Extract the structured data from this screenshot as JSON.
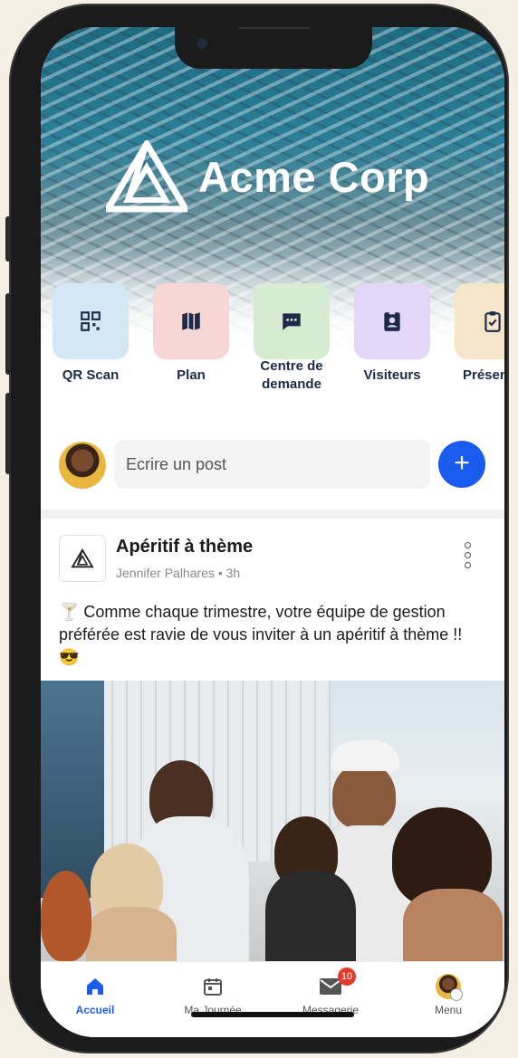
{
  "app": {
    "brand_name": "Acme Corp"
  },
  "shortcuts": [
    {
      "label": "QR Scan",
      "icon": "qr-code-icon",
      "color": "#d3e7f4"
    },
    {
      "label": "Plan",
      "icon": "map-icon",
      "color": "#f6d7d6"
    },
    {
      "label": "Centre de demande",
      "icon": "chat-bubble-icon",
      "color": "#d6ecd1"
    },
    {
      "label": "Visiteurs",
      "icon": "badge-icon",
      "color": "#e3d6f7"
    },
    {
      "label": "Présen",
      "icon": "clipboard-check-icon",
      "color": "#f5e6c9"
    }
  ],
  "composer": {
    "placeholder": "Ecrire un post",
    "add_label": "+"
  },
  "post": {
    "title": "Apéritif à thème",
    "meta": "Jennifer Palhares • 3h",
    "body": "🍸 Comme chaque trimestre, votre équipe de gestion préférée est ravie de vous inviter à un apéritif à thème !! 😎"
  },
  "tabbar": {
    "tabs": [
      {
        "label": "Accueil",
        "icon": "home-icon",
        "active": true
      },
      {
        "label": "Ma Journée",
        "icon": "calendar-icon"
      },
      {
        "label": "Messagerie",
        "icon": "mail-icon",
        "badge": "10"
      },
      {
        "label": "Menu",
        "icon": "avatar-icon"
      }
    ]
  },
  "colors": {
    "accent": "#1a5cf0",
    "badge": "#e5392a",
    "tile_text": "#1e2a4a"
  }
}
